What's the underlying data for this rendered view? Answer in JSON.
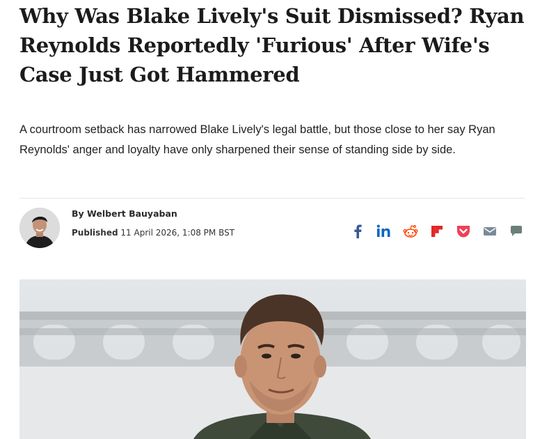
{
  "article": {
    "headline": "Why Was Blake Lively's Suit Dismissed? Ryan Reynolds Reportedly 'Furious' After Wife's Case Just Got Hammered",
    "standfirst": "A courtroom setback has narrowed Blake Lively's legal battle, but those close to her say Ryan Reynolds' anger and loyalty have only sharpened their sense of standing side by side."
  },
  "author": {
    "by_prefix": "By",
    "name": "Welbert Bauyaban",
    "published_label": "Published",
    "published_date": "11 April 2026, 1:08 PM BST"
  },
  "share": {
    "icons": [
      "facebook-icon",
      "linkedin-icon",
      "reddit-icon",
      "flipboard-icon",
      "pocket-icon",
      "email-icon",
      "comment-icon"
    ],
    "colors": {
      "facebook": "#3b5998",
      "linkedin": "#0a66c2",
      "reddit": "#ff4500",
      "flipboard": "#e12828",
      "pocket": "#ef4056",
      "email": "#7a8a99",
      "comment": "#6b7f7a"
    }
  },
  "hero_image": {
    "subject": "man-portrait-photo"
  }
}
